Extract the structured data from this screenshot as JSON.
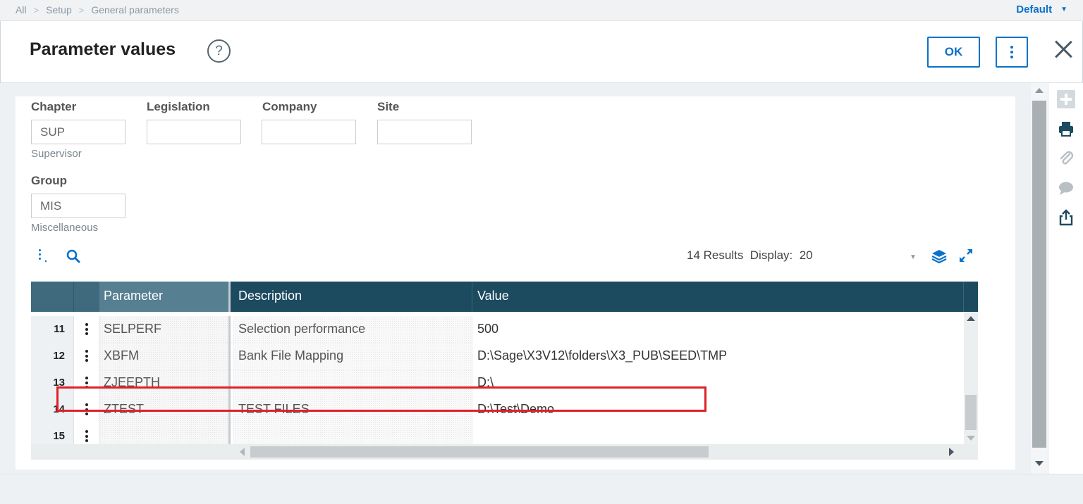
{
  "breadcrumb": [
    "All",
    "Setup",
    "General parameters"
  ],
  "profile": {
    "label": "Default"
  },
  "header": {
    "title": "Parameter values",
    "help_symbol": "?",
    "ok_label": "OK"
  },
  "fields": {
    "chapter": {
      "label": "Chapter",
      "value": "SUP",
      "description": "Supervisor"
    },
    "legislation": {
      "label": "Legislation",
      "value": ""
    },
    "company": {
      "label": "Company",
      "value": ""
    },
    "site": {
      "label": "Site",
      "value": ""
    },
    "group": {
      "label": "Group",
      "value": "MIS",
      "description": "Miscellaneous"
    }
  },
  "grid_toolbar": {
    "results": "14 Results",
    "display_label": "Display:",
    "display_value": "20"
  },
  "grid": {
    "columns": [
      "Parameter",
      "Description",
      "Value"
    ],
    "rows": [
      {
        "num": "11",
        "parameter": "SELPERF",
        "description": "Selection performance",
        "value": "500"
      },
      {
        "num": "12",
        "parameter": "XBFM",
        "description": "Bank File Mapping",
        "value": "D:\\Sage\\X3V12\\folders\\X3_PUB\\SEED\\TMP"
      },
      {
        "num": "13",
        "parameter": "ZJEEPTH",
        "description": "",
        "value": "D:\\"
      },
      {
        "num": "14",
        "parameter": "ZTEST",
        "description": "TEST FILES",
        "value": "D:\\Test\\Demo"
      },
      {
        "num": "15",
        "parameter": "",
        "description": "",
        "value": ""
      }
    ]
  },
  "colors": {
    "accent": "#0a72c8",
    "grid_header": "#1c4a5e",
    "highlight": "#e01f26"
  },
  "side_icons": [
    "add-icon",
    "print-icon",
    "attachment-icon",
    "comment-icon",
    "share-icon"
  ]
}
